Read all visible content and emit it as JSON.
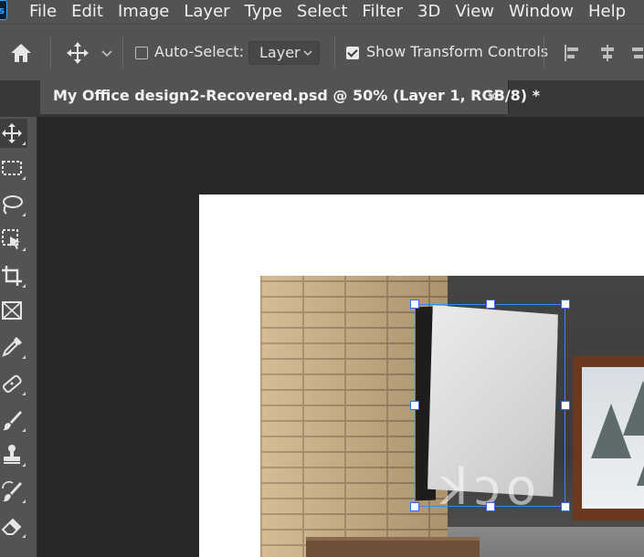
{
  "app": {
    "logo_text": "Ps"
  },
  "menu": {
    "items": [
      "File",
      "Edit",
      "Image",
      "Layer",
      "Type",
      "Select",
      "Filter",
      "3D",
      "View",
      "Window",
      "Help"
    ]
  },
  "options": {
    "auto_select_label": "Auto-Select:",
    "auto_select_checked": false,
    "layer_select_value": "Layer",
    "show_transform_label": "Show Transform Controls",
    "show_transform_checked": true
  },
  "document": {
    "tab_title": "My Office design2-Recovered.psd @ 50% (Layer 1, RGB/8) *",
    "close_icon": "close-icon"
  },
  "tools": [
    {
      "name": "move-tool",
      "icon": "move-icon",
      "active": true
    },
    {
      "name": "marquee-tool",
      "icon": "rect-marquee-icon"
    },
    {
      "name": "lasso-tool",
      "icon": "lasso-icon"
    },
    {
      "name": "object-select-tool",
      "icon": "object-select-icon"
    },
    {
      "name": "crop-tool",
      "icon": "crop-icon"
    },
    {
      "name": "frame-tool",
      "icon": "frame-icon"
    },
    {
      "name": "eyedropper-tool",
      "icon": "eyedropper-icon"
    },
    {
      "name": "healing-brush-tool",
      "icon": "bandage-icon"
    },
    {
      "name": "brush-tool",
      "icon": "brush-icon"
    },
    {
      "name": "clone-stamp-tool",
      "icon": "stamp-icon"
    },
    {
      "name": "history-brush-tool",
      "icon": "history-brush-icon"
    },
    {
      "name": "eraser-tool",
      "icon": "eraser-icon"
    }
  ],
  "canvas": {
    "watermark_text": "ock",
    "colors": {
      "transform_accent": "#3d86f0",
      "app_bg": "#282828",
      "panel_bg": "#535353"
    }
  }
}
